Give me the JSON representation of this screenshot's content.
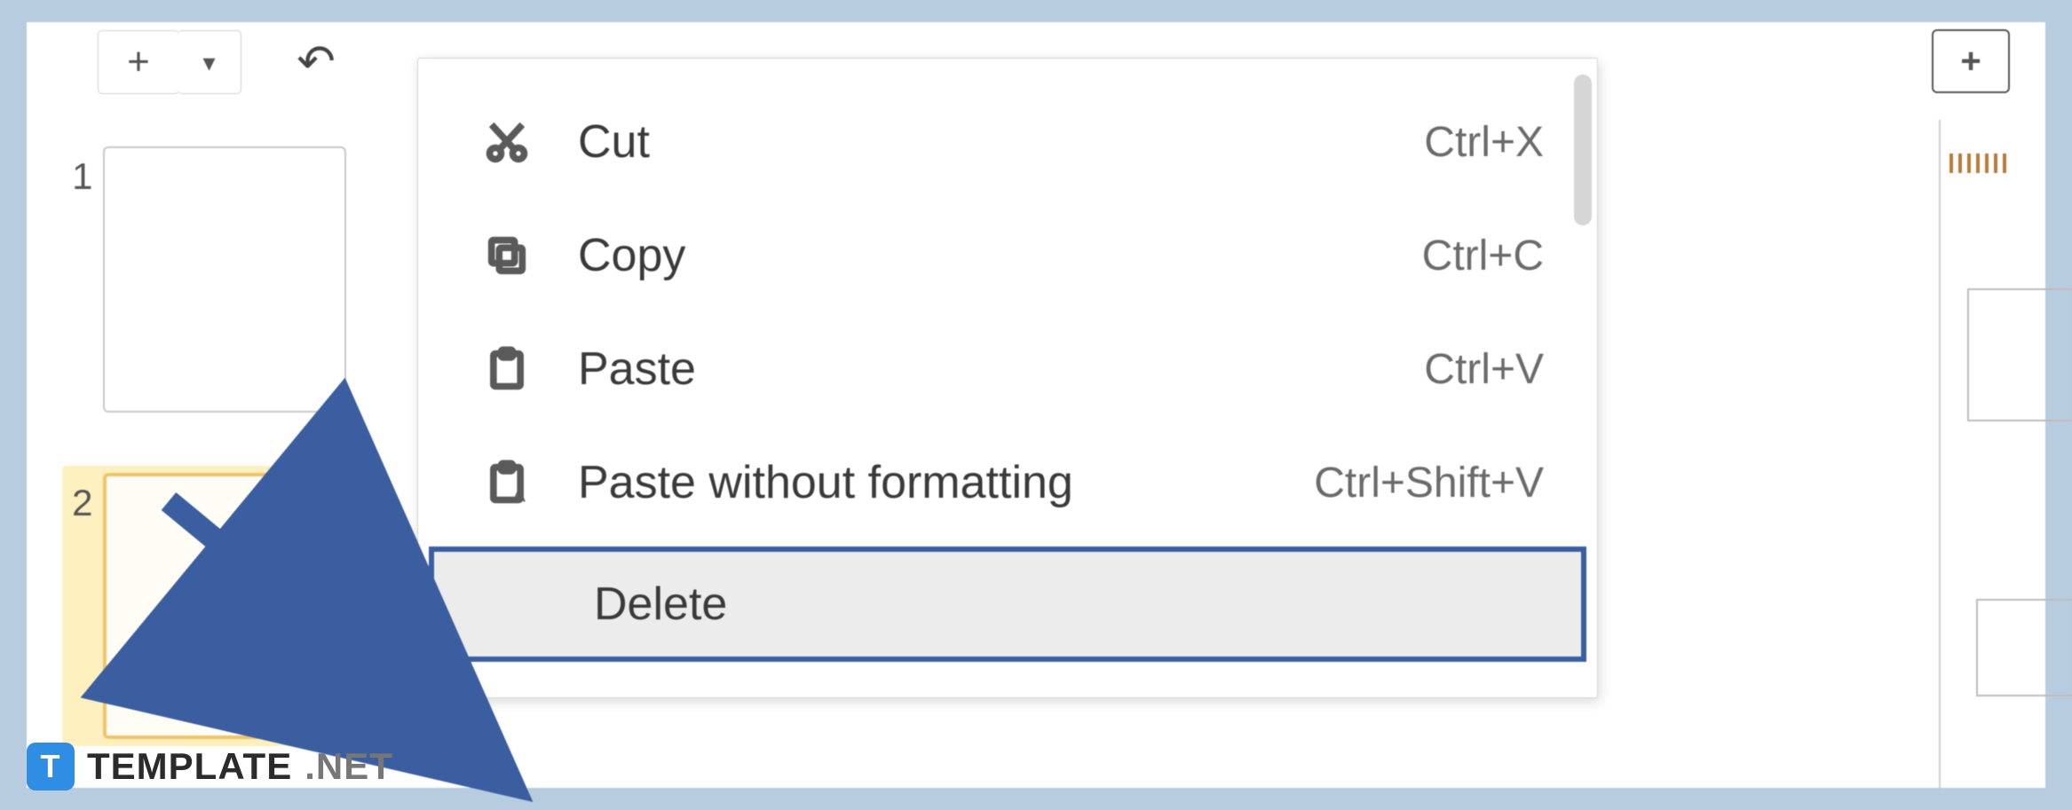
{
  "toolbar": {
    "new_label": "+",
    "caret_label": "▾",
    "undo_label": "↶",
    "comment_label": "+"
  },
  "thumbnails": {
    "slide1_num": "1",
    "slide2_num": "2"
  },
  "context_menu": {
    "items": [
      {
        "icon": "cut-icon",
        "label": "Cut",
        "shortcut": "Ctrl+X"
      },
      {
        "icon": "copy-icon",
        "label": "Copy",
        "shortcut": "Ctrl+C"
      },
      {
        "icon": "paste-icon",
        "label": "Paste",
        "shortcut": "Ctrl+V"
      },
      {
        "icon": "paste-plain-icon",
        "label": "Paste without formatting",
        "shortcut": "Ctrl+Shift+V"
      },
      {
        "icon": "",
        "label": "Delete",
        "shortcut": ""
      }
    ],
    "highlighted_index": 4
  },
  "annotation": {
    "arrow_color": "#3b5ea0"
  },
  "watermark": {
    "badge": "T",
    "brand": "TEMPLATE",
    "suffix": ".NET"
  }
}
